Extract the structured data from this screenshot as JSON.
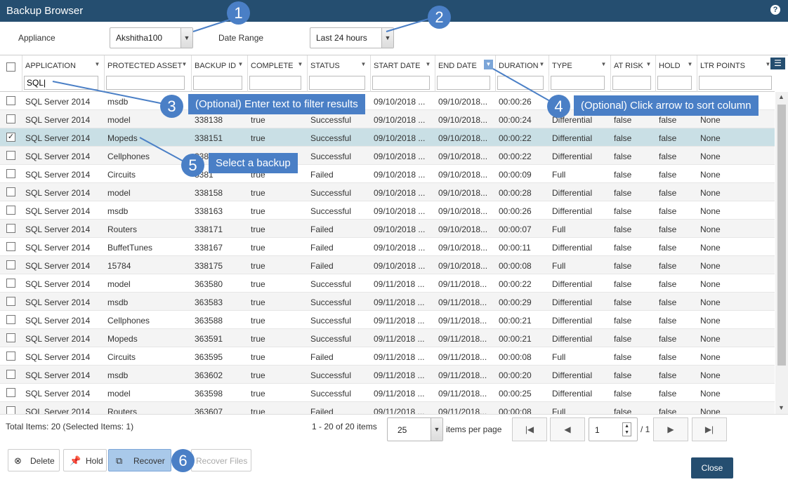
{
  "window": {
    "title": "Backup Browser",
    "help_icon": "help-icon"
  },
  "filters": {
    "appliance_label": "Appliance",
    "appliance_value": "Akshitha100",
    "date_range_label": "Date Range",
    "date_range_value": "Last 24 hours"
  },
  "columns": [
    {
      "key": "application",
      "label": "APPLICATION",
      "filter": "SQL|"
    },
    {
      "key": "asset",
      "label": "PROTECTED ASSET",
      "filter": ""
    },
    {
      "key": "backup_id",
      "label": "BACKUP ID",
      "filter": ""
    },
    {
      "key": "complete",
      "label": "COMPLETE",
      "filter": ""
    },
    {
      "key": "status",
      "label": "STATUS",
      "filter": ""
    },
    {
      "key": "start",
      "label": "START DATE",
      "filter": ""
    },
    {
      "key": "end",
      "label": "END DATE",
      "filter": ""
    },
    {
      "key": "duration",
      "label": "DURATION",
      "filter": ""
    },
    {
      "key": "type",
      "label": "TYPE",
      "filter": ""
    },
    {
      "key": "at_risk",
      "label": "AT RISK",
      "filter": ""
    },
    {
      "key": "hold",
      "label": "HOLD",
      "filter": ""
    },
    {
      "key": "ltr",
      "label": "LTR POINTS",
      "filter": ""
    }
  ],
  "rows": [
    [
      "SQL Server 2014",
      "msdb",
      "",
      "",
      "",
      "09/10/2018 ...",
      "09/10/2018...",
      "00:00:26",
      "",
      "",
      "",
      ""
    ],
    [
      "SQL Server 2014",
      "model",
      "338138",
      "true",
      "Successful",
      "09/10/2018 ...",
      "09/10/2018...",
      "00:00:24",
      "Differential",
      "false",
      "false",
      "None"
    ],
    [
      "SQL Server 2014",
      "Mopeds",
      "338151",
      "true",
      "Successful",
      "09/10/2018 ...",
      "09/10/2018...",
      "00:00:22",
      "Differential",
      "false",
      "false",
      "None"
    ],
    [
      "SQL Server 2014",
      "Cellphones",
      "",
      "",
      "Successful",
      "09/10/2018 ...",
      "09/10/2018...",
      "00:00:22",
      "Differential",
      "false",
      "false",
      "None"
    ],
    [
      "SQL Server 2014",
      "Circuits",
      "",
      "",
      "Failed",
      "09/10/2018 ...",
      "09/10/2018...",
      "00:00:09",
      "Full",
      "false",
      "false",
      "None"
    ],
    [
      "SQL Server 2014",
      "model",
      "338158",
      "true",
      "Successful",
      "09/10/2018 ...",
      "09/10/2018...",
      "00:00:28",
      "Differential",
      "false",
      "false",
      "None"
    ],
    [
      "SQL Server 2014",
      "msdb",
      "338163",
      "true",
      "Successful",
      "09/10/2018 ...",
      "09/10/2018...",
      "00:00:26",
      "Differential",
      "false",
      "false",
      "None"
    ],
    [
      "SQL Server 2014",
      "Routers",
      "338171",
      "true",
      "Failed",
      "09/10/2018 ...",
      "09/10/2018...",
      "00:00:07",
      "Full",
      "false",
      "false",
      "None"
    ],
    [
      "SQL Server 2014",
      "BuffetTunes",
      "338167",
      "true",
      "Failed",
      "09/10/2018 ...",
      "09/10/2018...",
      "00:00:11",
      "Differential",
      "false",
      "false",
      "None"
    ],
    [
      "SQL Server 2014",
      "15784",
      "338175",
      "true",
      "Failed",
      "09/10/2018 ...",
      "09/10/2018...",
      "00:00:08",
      "Full",
      "false",
      "false",
      "None"
    ],
    [
      "SQL Server 2014",
      "model",
      "363580",
      "true",
      "Successful",
      "09/11/2018 ...",
      "09/11/2018...",
      "00:00:22",
      "Differential",
      "false",
      "false",
      "None"
    ],
    [
      "SQL Server 2014",
      "msdb",
      "363583",
      "true",
      "Successful",
      "09/11/2018 ...",
      "09/11/2018...",
      "00:00:29",
      "Differential",
      "false",
      "false",
      "None"
    ],
    [
      "SQL Server 2014",
      "Cellphones",
      "363588",
      "true",
      "Successful",
      "09/11/2018 ...",
      "09/11/2018...",
      "00:00:21",
      "Differential",
      "false",
      "false",
      "None"
    ],
    [
      "SQL Server 2014",
      "Mopeds",
      "363591",
      "true",
      "Successful",
      "09/11/2018 ...",
      "09/11/2018...",
      "00:00:21",
      "Differential",
      "false",
      "false",
      "None"
    ],
    [
      "SQL Server 2014",
      "Circuits",
      "363595",
      "true",
      "Failed",
      "09/11/2018 ...",
      "09/11/2018...",
      "00:00:08",
      "Full",
      "false",
      "false",
      "None"
    ],
    [
      "SQL Server 2014",
      "msdb",
      "363602",
      "true",
      "Successful",
      "09/11/2018 ...",
      "09/11/2018...",
      "00:00:20",
      "Differential",
      "false",
      "false",
      "None"
    ],
    [
      "SQL Server 2014",
      "model",
      "363598",
      "true",
      "Successful",
      "09/11/2018 ...",
      "09/11/2018...",
      "00:00:25",
      "Differential",
      "false",
      "false",
      "None"
    ],
    [
      "SQL Server 2014",
      "Routers",
      "363607",
      "true",
      "Failed",
      "09/11/2018 ...",
      "09/11/2018...",
      "00:00:08",
      "Full",
      "false",
      "false",
      "None"
    ]
  ],
  "selected_row": 2,
  "partial_cells": {
    "row3_id": "3381",
    "row4_id": "3381",
    "row4_complete": "true"
  },
  "footer": {
    "total_items": "Total Items: 20 (Selected Items: 1)",
    "range": "1 - 20 of 20 items",
    "page_size": "25",
    "items_per_page": "items per page",
    "page": "1",
    "page_total": "/ 1"
  },
  "actions": {
    "delete": "Delete",
    "hold": "Hold",
    "recover": "Recover",
    "recover_files": "Recover Files",
    "close": "Close"
  },
  "callouts": {
    "c1": "1",
    "c2": "2",
    "c3_num": "3",
    "c3_text": "(Optional) Enter text to filter results",
    "c4_num": "4",
    "c4_text": "(Optional) Click arrow to sort column",
    "c5_num": "5",
    "c5_text": "Select a backup",
    "c6": "6"
  },
  "colors": {
    "titlebar": "#254e70",
    "callout": "#4a7fc6",
    "selected_row": "#c9dfe5"
  }
}
